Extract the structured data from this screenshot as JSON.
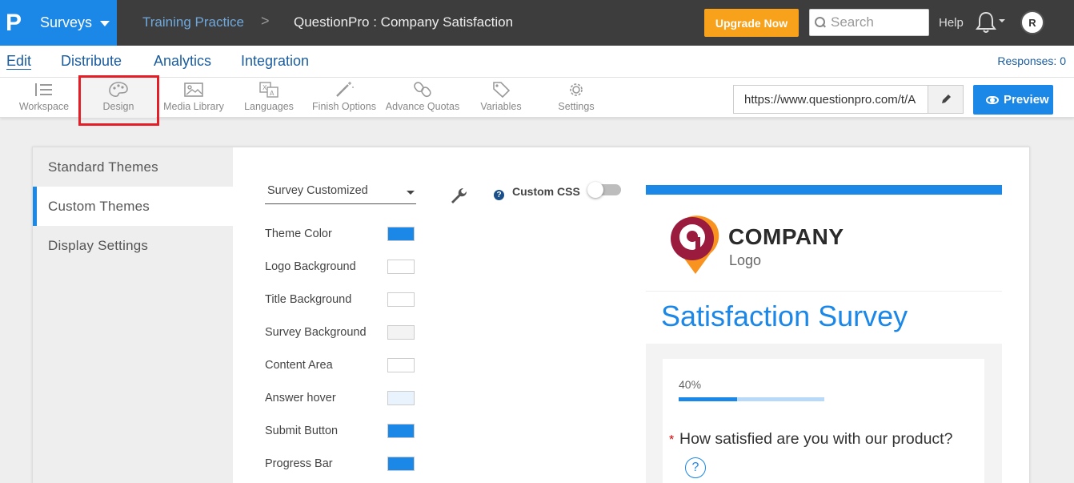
{
  "topbar": {
    "logo_letter": "P",
    "app_label": "Surveys",
    "breadcrumb_folder": "Training Practice",
    "breadcrumb_sep": ">",
    "breadcrumb_survey": "QuestionPro : Company Satisfaction",
    "upgrade_label": "Upgrade Now",
    "search_placeholder": "Search",
    "help_label": "Help",
    "avatar_initial": "R"
  },
  "menu": {
    "items": [
      "Edit",
      "Distribute",
      "Analytics",
      "Integration"
    ],
    "active": "Edit",
    "responses_label": "Responses: 0"
  },
  "toolbar": {
    "tools": [
      {
        "label": "Workspace",
        "icon": "list-pencil-icon"
      },
      {
        "label": "Design",
        "icon": "palette-icon"
      },
      {
        "label": "Media Library",
        "icon": "image-icon"
      },
      {
        "label": "Languages",
        "icon": "translate-icon"
      },
      {
        "label": "Finish Options",
        "icon": "magic-wand-icon"
      },
      {
        "label": "Advance Quotas",
        "icon": "link-icon"
      },
      {
        "label": "Variables",
        "icon": "tag-icon"
      },
      {
        "label": "Settings",
        "icon": "gear-icon"
      }
    ],
    "selected": "Design",
    "survey_url": "https://www.questionpro.com/t/A",
    "preview_label": "Preview"
  },
  "sidebar": {
    "items": [
      "Standard Themes",
      "Custom Themes",
      "Display Settings"
    ],
    "active": "Custom Themes"
  },
  "theme": {
    "selected_theme": "Survey Customized",
    "custom_css_label": "Custom CSS",
    "custom_css_enabled": false,
    "colors": [
      {
        "label": "Theme Color",
        "color": "#1b87e6"
      },
      {
        "label": "Logo Background",
        "color": "#ffffff"
      },
      {
        "label": "Title Background",
        "color": "#ffffff"
      },
      {
        "label": "Survey Background",
        "color": "#f3f3f3"
      },
      {
        "label": "Content Area",
        "color": "#ffffff"
      },
      {
        "label": "Answer hover",
        "color": "#e8f3fd"
      },
      {
        "label": "Submit Button",
        "color": "#1b87e6"
      },
      {
        "label": "Progress Bar",
        "color": "#1b87e6"
      }
    ]
  },
  "preview": {
    "company_name": "COMPANY",
    "logo_sub": "Logo",
    "survey_title": "Satisfaction Survey",
    "progress_label": "40%",
    "progress_value": 0.4,
    "required_mark": "*",
    "question_text": "How satisfied are you with our product?",
    "help_glyph": "?"
  }
}
